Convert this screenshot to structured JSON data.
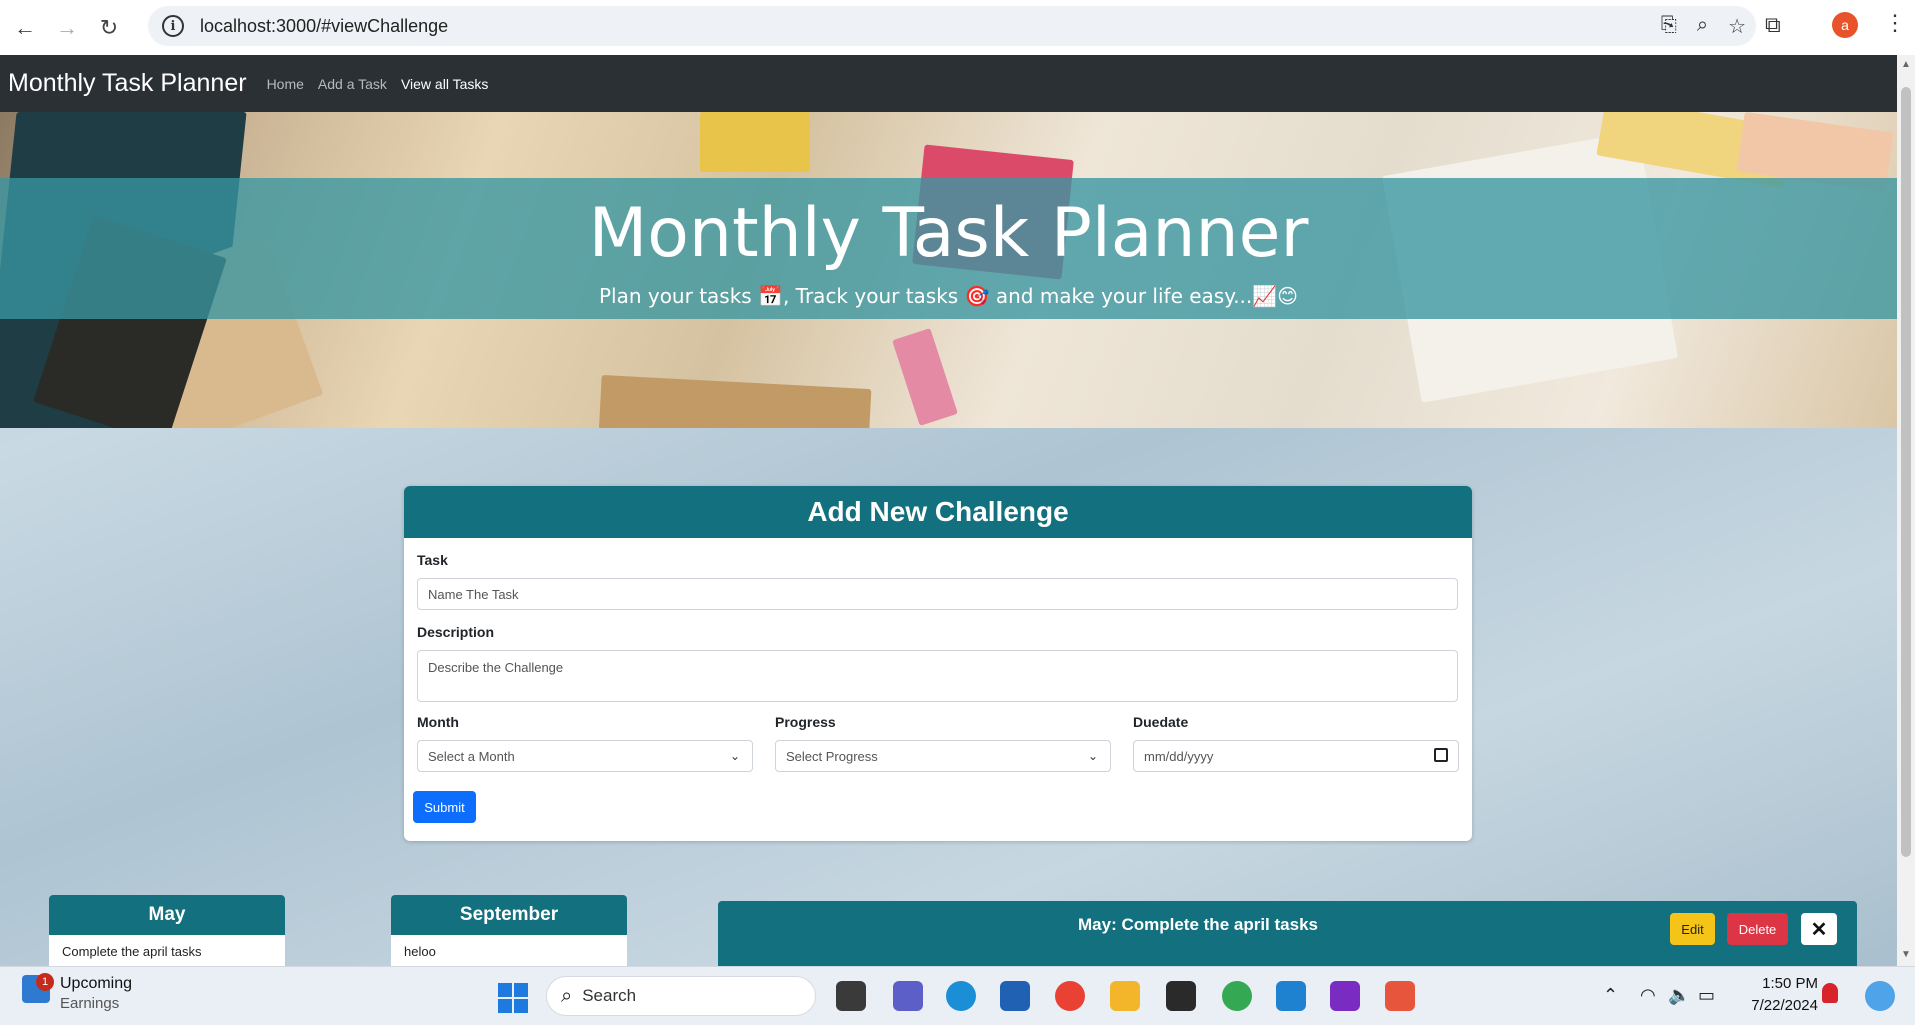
{
  "browser": {
    "url": "localhost:3000/#viewChallenge",
    "profile_initial": "a",
    "icons": [
      "back-icon",
      "forward-icon",
      "reload-icon",
      "site-info-icon",
      "install-app-icon",
      "zoom-icon",
      "bookmark-star-icon",
      "extensions-icon",
      "menu-icon"
    ]
  },
  "navbar": {
    "brand": "Monthly Task Planner",
    "links": [
      "Home",
      "Add a Task",
      "View all Tasks"
    ],
    "active_link": "View all Tasks"
  },
  "hero": {
    "title": "Monthly Task Planner",
    "subtitle": "Plan your tasks 📅, Track your tasks 🎯 and make your life easy...📈😊"
  },
  "form": {
    "heading": "Add New Challenge",
    "task_label": "Task",
    "task_placeholder": "Name The Task",
    "description_label": "Description",
    "description_placeholder": "Describe the Challenge",
    "month_label": "Month",
    "month_value": "Select a Month",
    "progress_label": "Progress",
    "progress_value": "Select Progress",
    "duedate_label": "Duedate",
    "duedate_value": "mm/dd/yyyy",
    "submit_label": "Submit"
  },
  "month_cards": [
    {
      "month": "May",
      "task": "Complete the april tasks"
    },
    {
      "month": "September",
      "task": "heloo"
    }
  ],
  "detail": {
    "title": "May: Complete the april tasks",
    "edit_label": "Edit",
    "delete_label": "Delete",
    "close_label": "✕"
  },
  "taskbar": {
    "widget_badge": "1",
    "widget_title": "Upcoming",
    "widget_subtitle": "Earnings",
    "search_label": "Search",
    "time": "1:50 PM",
    "date": "7/22/2024"
  },
  "colors": {
    "navbar": "#2b3035",
    "accent_teal": "#13707f",
    "primary_button": "#0d6efd",
    "edit_button": "#f5c419",
    "delete_button": "#dc3545"
  }
}
